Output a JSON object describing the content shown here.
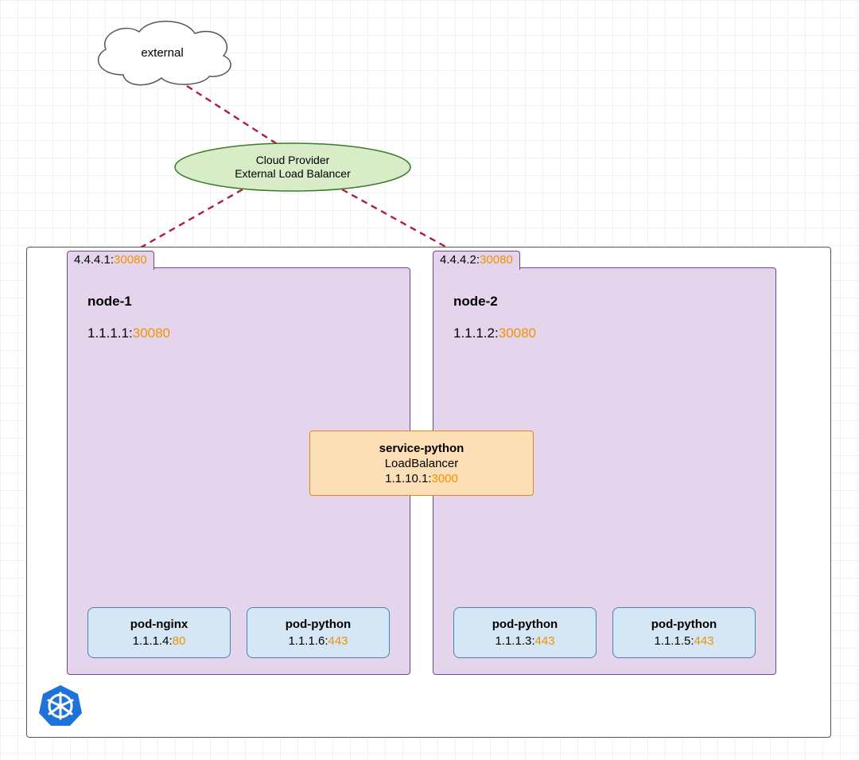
{
  "external": {
    "label": "external"
  },
  "loadBalancer": {
    "line1": "Cloud Provider",
    "line2": "External Load Balancer"
  },
  "cluster": {
    "nodes": [
      {
        "name": "node-1",
        "extIp": "4.4.4.1",
        "extPort": "30080",
        "intIp": "1.1.1.1",
        "intPort": "30080",
        "pods": [
          {
            "name": "pod-nginx",
            "ip": "1.1.1.4",
            "port": "80"
          },
          {
            "name": "pod-python",
            "ip": "1.1.1.6",
            "port": "443"
          }
        ]
      },
      {
        "name": "node-2",
        "extIp": "4.4.4.2",
        "extPort": "30080",
        "intIp": "1.1.1.2",
        "intPort": "30080",
        "pods": [
          {
            "name": "pod-python",
            "ip": "1.1.1.3",
            "port": "443"
          },
          {
            "name": "pod-python",
            "ip": "1.1.1.5",
            "port": "443"
          }
        ]
      }
    ],
    "service": {
      "name": "service-python",
      "type": "LoadBalancer",
      "ip": "1.1.10.1",
      "port": "3000"
    }
  },
  "icon": "kubernetes"
}
